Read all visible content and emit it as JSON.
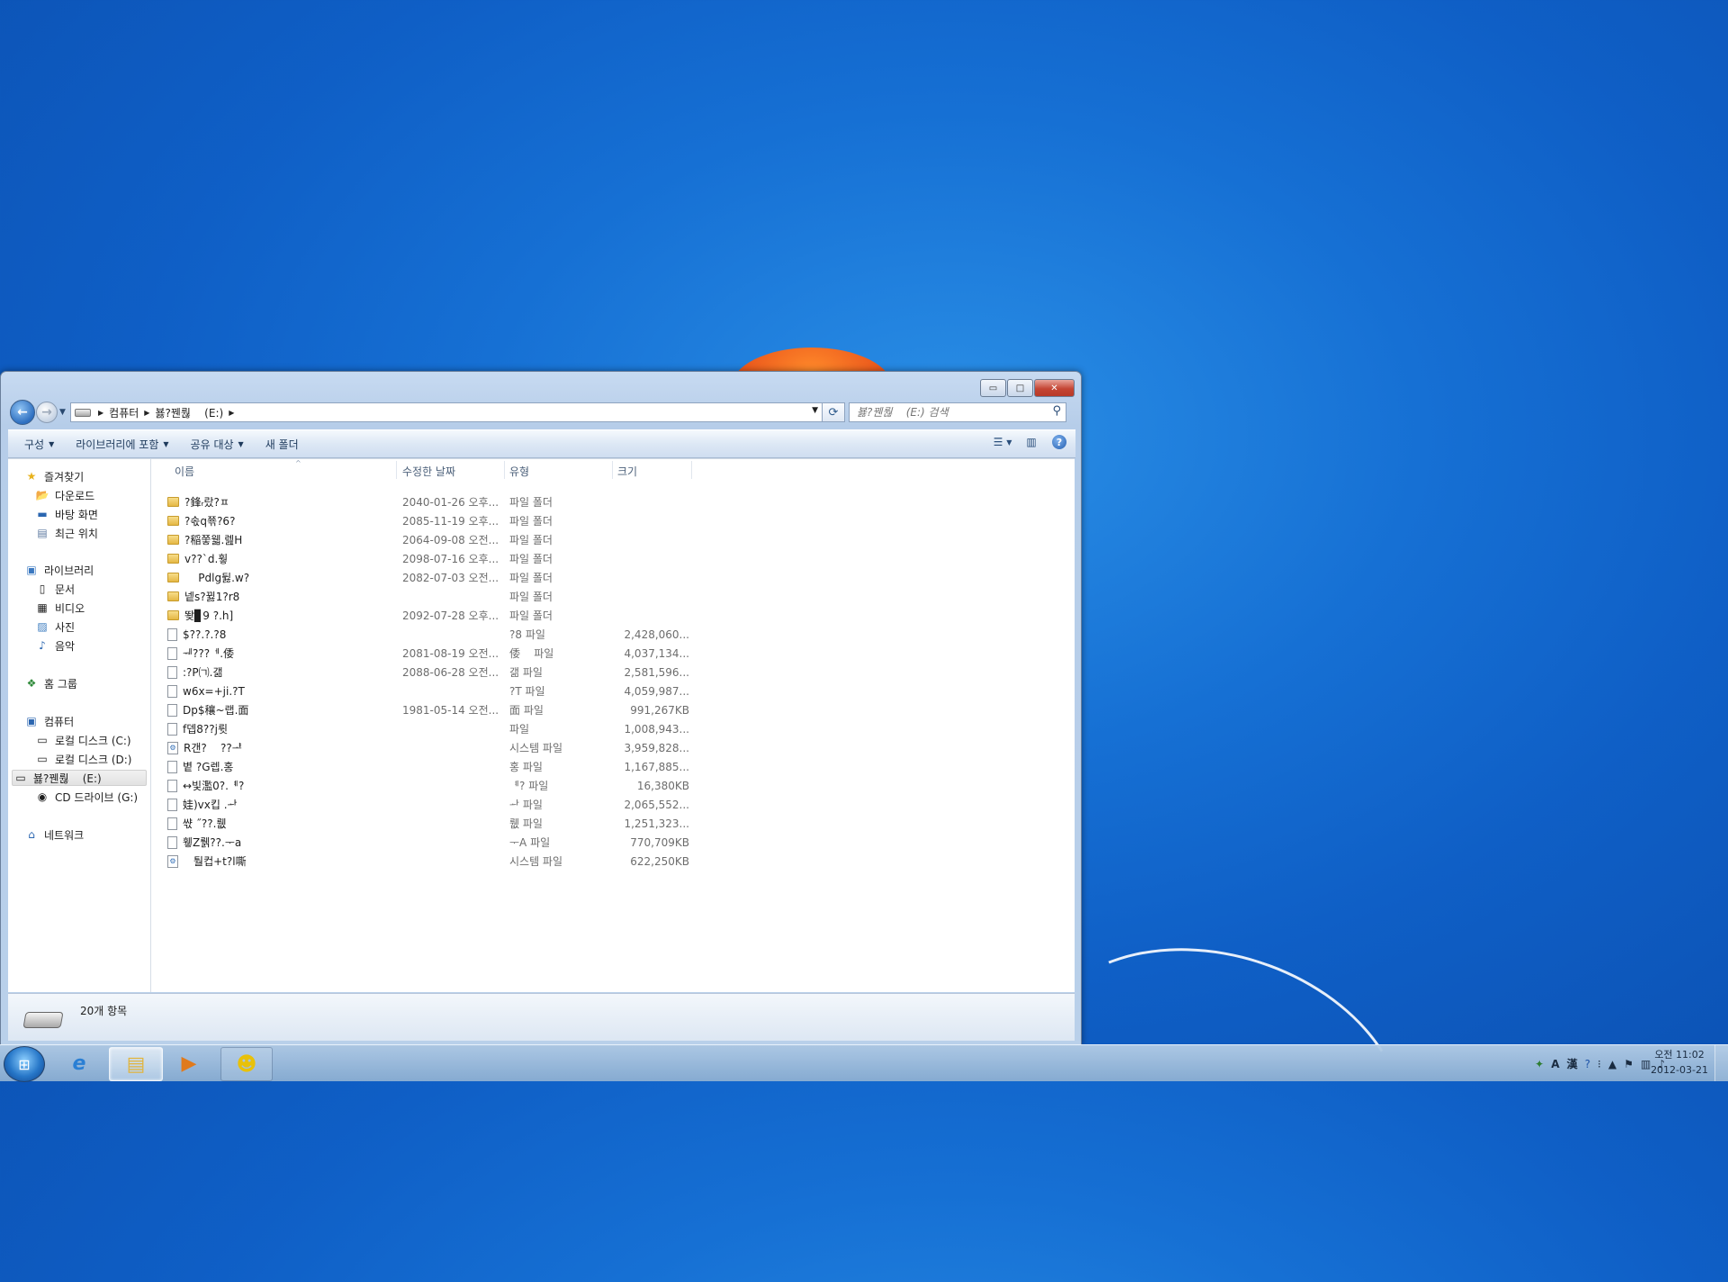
{
  "window": {
    "caption_buttons": {
      "minimize": "▭",
      "maximize": "□",
      "close": "✕"
    },
    "breadcrumb": [
      "컴퓨터",
      "뵳?꿴뤊    (E:)"
    ],
    "search_placeholder": "뵳?꿴뤊    (E:) 검색",
    "toolbar": {
      "organize": "구성",
      "include_library": "라이브러리에 포함",
      "share_with": "공유 대상",
      "new_folder": "새 폴더"
    },
    "status_count": "20개 항목"
  },
  "nav": {
    "favorites": "즐겨찾기",
    "downloads": "다운로드",
    "desktop": "바탕 화면",
    "recent": "최근 위치",
    "libraries": "라이브러리",
    "documents": "문서",
    "videos": "비디오",
    "pictures": "사진",
    "music": "음악",
    "homegroup": "홈 그룹",
    "computer": "컴퓨터",
    "drive_c": "로컬 디스크 (C:)",
    "drive_d": "로컬 디스크 (D:)",
    "drive_e": "뵳?꿴뤊    (E:)",
    "drive_g": "CD 드라이브 (G:)",
    "network": "네트워크"
  },
  "columns": {
    "name": "이름",
    "date": "수정한 날짜",
    "type": "유형",
    "size": "크기"
  },
  "files": [
    {
      "name": "?鋒ᵣ랐?ㅍ",
      "date": "2040-01-26 오후...",
      "type": "파일 폴더",
      "size": "",
      "kind": "folder"
    },
    {
      "name": "?솏q쬮?6?",
      "date": "2085-11-19 오후...",
      "type": "파일 폴더",
      "size": "",
      "kind": "folder"
    },
    {
      "name": "?稲쭣웳.렖H",
      "date": "2064-09-08 오전...",
      "type": "파일 폴더",
      "size": "",
      "kind": "folder"
    },
    {
      "name": "v??`d.훻",
      "date": "2098-07-16 오후...",
      "type": "파일 폴더",
      "size": "",
      "kind": "folder"
    },
    {
      "name": "    Pdlg뒳.w?",
      "date": "2082-07-03 오전...",
      "type": "파일 폴더",
      "size": "",
      "kind": "folder"
    },
    {
      "name": "넽s?뀛1?r8",
      "date": "",
      "type": "파일 폴더",
      "size": "",
      "kind": "folder"
    },
    {
      "name": "뙂▊9 ?.h]",
      "date": "2092-07-28 오후...",
      "type": "파일 폴더",
      "size": "",
      "kind": "folder"
    },
    {
      "name": "$??.?.?8",
      "date": "",
      "type": "?8 파일",
      "size": "2,428,060...",
      "kind": "file"
    },
    {
      "name": "ᅰ???ᅦ.倭",
      "date": "2081-08-19 오전...",
      "type": "倭    파일",
      "size": "4,037,134...",
      "kind": "file"
    },
    {
      "name": ":?P㈀.갦",
      "date": "2088-06-28 오전...",
      "type": "갦 파일",
      "size": "2,581,596...",
      "kind": "file"
    },
    {
      "name": "w6x=+ji.?T",
      "date": "",
      "type": "?T 파일",
      "size": "4,059,987...",
      "kind": "file"
    },
    {
      "name": "Dp$穰~랩.面",
      "date": "1981-05-14 오전...",
      "type": "面 파일",
      "size": "991,267KB",
      "kind": "file"
    },
    {
      "name": "f뎁8??j륏",
      "date": "",
      "type": "파일",
      "size": "1,008,943...",
      "kind": "file"
    },
    {
      "name": "R갠?    ??ᅸ",
      "date": "",
      "type": "시스템 파일",
      "size": "3,959,828...",
      "kind": "sys"
    },
    {
      "name": "볕 ?G렙.홍",
      "date": "",
      "type": "홍 파일",
      "size": "1,167,885...",
      "kind": "file"
    },
    {
      "name": "↔빛濫0?.ᅨ?",
      "date": "",
      "type": "ᅨ? 파일",
      "size": "16,380KB",
      "kind": "file"
    },
    {
      "name": "娃)vx킵 .ᅪ",
      "date": "",
      "type": "ᅪ 파일",
      "size": "2,065,552...",
      "kind": "file"
    },
    {
      "name": "쌳 ˝??.뤲",
      "date": "",
      "type": "뤲 파일",
      "size": "1,251,323...",
      "kind": "file"
    },
    {
      "name": "휗Z뤩??.ᅮa",
      "date": "",
      "type": "ᅮA 파일",
      "size": "770,709KB",
      "kind": "file"
    },
    {
      "name": "ᅠ퉐컵+t?l嘶",
      "date": "",
      "type": "시스템 파일",
      "size": "622,250KB",
      "kind": "sys"
    }
  ],
  "taskbar": {
    "clock_time": "오전 11:02",
    "clock_date": "2012-03-21",
    "ime_a": "A",
    "ime_han": "漢"
  }
}
